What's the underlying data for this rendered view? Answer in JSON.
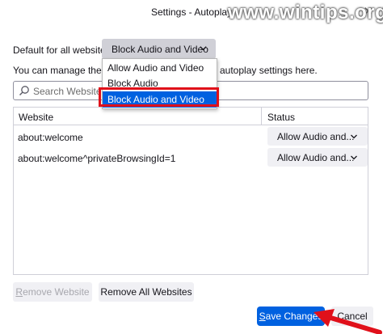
{
  "window": {
    "title": "Settings - Autoplay",
    "close_glyph": "✕"
  },
  "watermark": "www.wintips.org",
  "default_setting": {
    "label": "Default for all websites:",
    "selected": "Block Audio and Video",
    "options": [
      "Allow Audio and Video",
      "Block Audio",
      "Block Audio and Video"
    ],
    "highlighted_option_index": 2
  },
  "manage_text": {
    "visible_left": "You can manage the site",
    "visible_right": "autoplay settings here."
  },
  "search": {
    "placeholder": "Search Website"
  },
  "table": {
    "columns": [
      "Website",
      "Status"
    ],
    "rows": [
      {
        "website": "about:welcome",
        "status": "Allow Audio and..."
      },
      {
        "website": "about:welcome^privateBrowsingId=1",
        "status": "Allow Audio and..."
      }
    ]
  },
  "buttons": {
    "remove_website": {
      "key": "R",
      "rest": "emove Website",
      "enabled": false
    },
    "remove_all": {
      "key": "",
      "rest": "Remove All Websites"
    },
    "save": {
      "key": "S",
      "rest": "ave Changes"
    },
    "cancel": "Cancel"
  },
  "colors": {
    "accent": "#0061e0",
    "highlight_border": "#e0101a",
    "arrow": "#e0101a"
  },
  "icons": [
    "close-icon",
    "chevron-down-icon",
    "search-icon",
    "arrow-annotation"
  ]
}
